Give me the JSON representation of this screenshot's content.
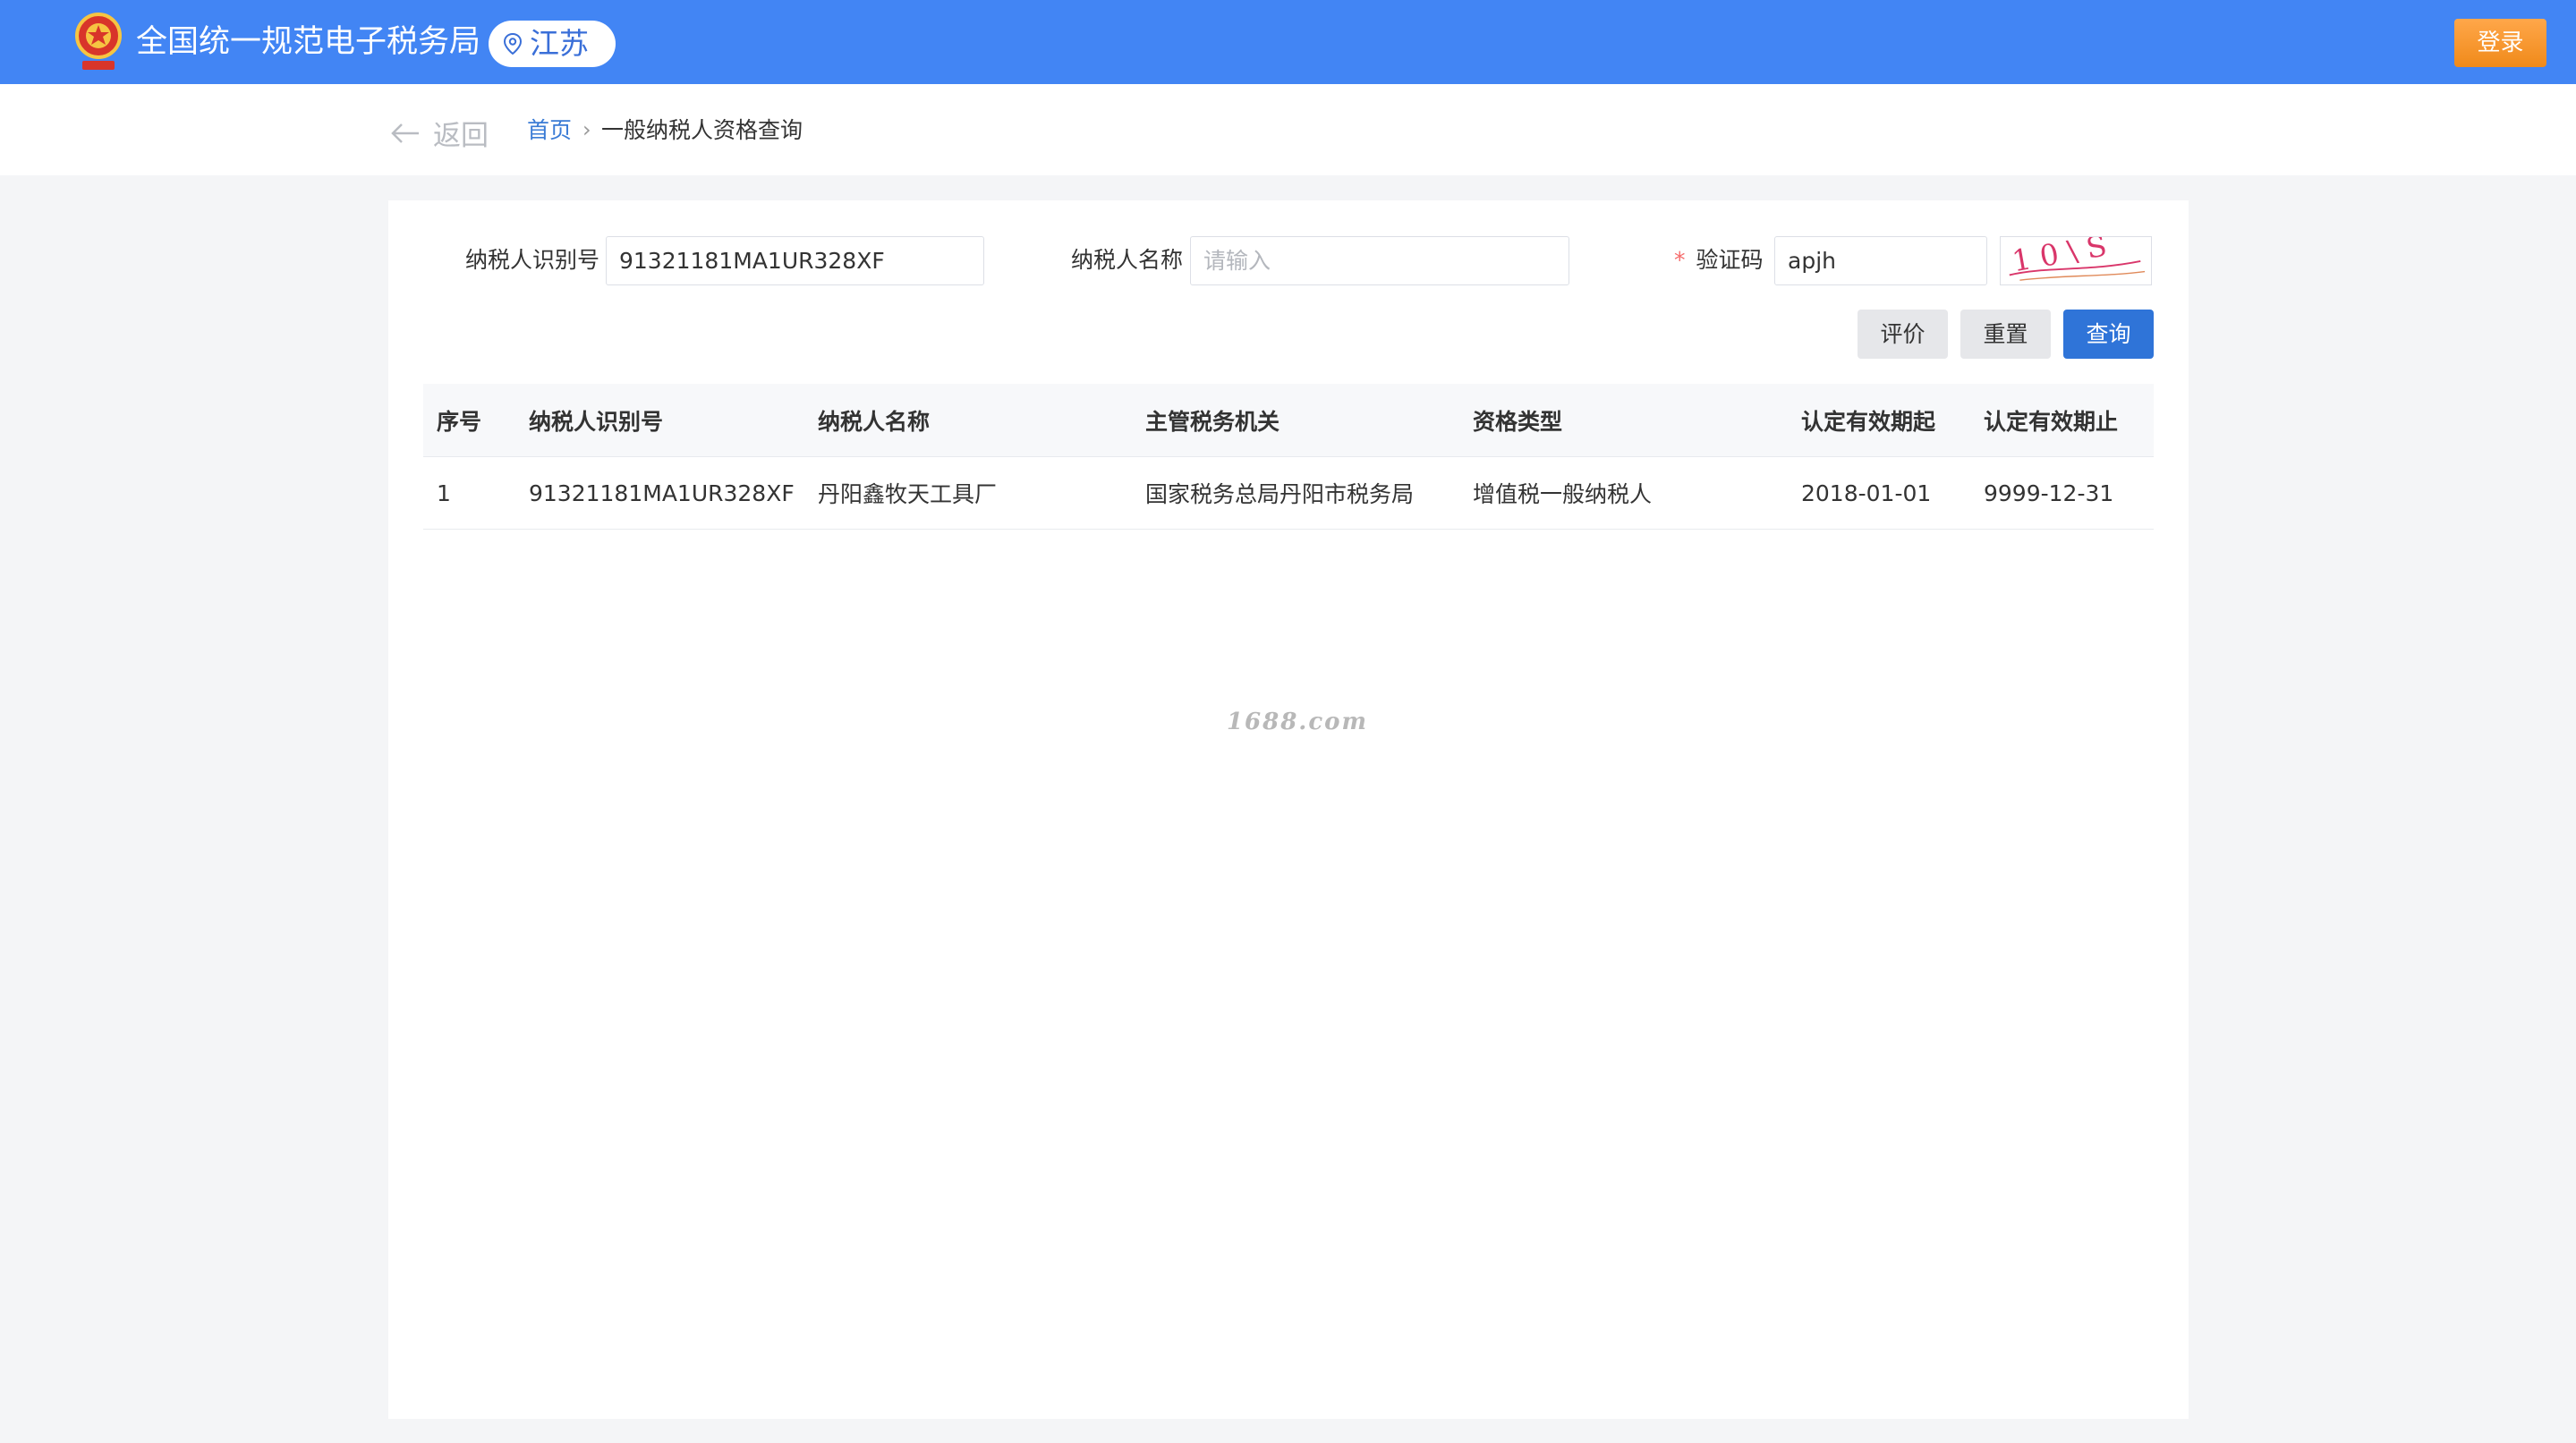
{
  "header": {
    "title": "全国统一规范电子税务局",
    "region": "江苏",
    "login_label": "登录"
  },
  "nav": {
    "back_label": "返回",
    "breadcrumb_home": "首页",
    "breadcrumb_separator": "›",
    "breadcrumb_current": "一般纳税人资格查询"
  },
  "form": {
    "taxpayer_id_label": "纳税人识别号",
    "taxpayer_id_value": "91321181MA1UR328XF",
    "taxpayer_name_label": "纳税人名称",
    "taxpayer_name_value": "",
    "taxpayer_name_placeholder": "请输入",
    "captcha_required_mark": "*",
    "captcha_label": "验证码",
    "captcha_value": "apjh",
    "captcha_image_text": "1 0 \\ S",
    "evaluate_label": "评价",
    "reset_label": "重置",
    "query_label": "查询"
  },
  "table": {
    "headers": [
      "序号",
      "纳税人识别号",
      "纳税人名称",
      "主管税务机关",
      "资格类型",
      "认定有效期起",
      "认定有效期止"
    ],
    "rows": [
      [
        "1",
        "91321181MA1UR328XF",
        "丹阳鑫牧天工具厂",
        "国家税务总局丹阳市税务局",
        "增值税一般纳税人",
        "2018-01-01",
        "9999-12-31"
      ]
    ]
  },
  "watermark": "1688.com",
  "colors": {
    "header_bg": "#4285f4",
    "login_bg": "#f08a1a",
    "query_button": "#2f74d8",
    "link": "#3a7bd5",
    "required": "#f56c6c"
  },
  "icons": {
    "emblem": "national-tax-emblem-icon",
    "region": "location-pin-icon",
    "back": "arrow-left-icon"
  }
}
